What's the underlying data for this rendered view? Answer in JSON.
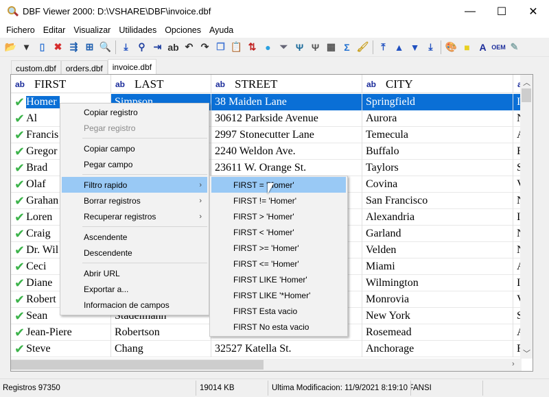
{
  "window": {
    "title": "DBF Viewer 2000: D:\\VSHARE\\DBF\\invoice.dbf",
    "minimize": "—",
    "maximize": "☐",
    "close": "✕"
  },
  "menubar": [
    "Fichero",
    "Editar",
    "Visualizar",
    "Utilidades",
    "Opciones",
    "Ayuda"
  ],
  "toolbar": [
    {
      "name": "open-folder-icon",
      "g": "📂",
      "c": "#d9a520"
    },
    {
      "name": "dropdown-arrow-icon",
      "g": "▾",
      "c": "#333"
    },
    {
      "name": "new-file-icon",
      "g": "▯",
      "c": "#3a7bd5"
    },
    {
      "name": "delete-icon",
      "g": "✖",
      "c": "#d62c2c"
    },
    {
      "name": "link-fields-icon",
      "g": "⇶",
      "c": "#2060b0"
    },
    {
      "name": "structure-icon",
      "g": "⊞",
      "c": "#2060b0"
    },
    {
      "name": "find-icon",
      "g": "🔍",
      "c": "#333"
    },
    "|",
    {
      "name": "goto-record-icon",
      "g": "⤓",
      "c": "#2050c0"
    },
    {
      "name": "binoculars-icon",
      "g": "⚲",
      "c": "#2040a0"
    },
    {
      "name": "find-next-icon",
      "g": "⇥",
      "c": "#2040a0"
    },
    {
      "name": "replace-icon",
      "g": "ab",
      "c": "#333"
    },
    {
      "name": "undo-icon",
      "g": "↶",
      "c": "#333"
    },
    {
      "name": "redo-icon",
      "g": "↷",
      "c": "#333"
    },
    {
      "name": "copy-icon",
      "g": "❐",
      "c": "#4a7bd5"
    },
    {
      "name": "paste-icon",
      "g": "📋",
      "c": "#777"
    },
    {
      "name": "sort-az-icon",
      "g": "⇅",
      "c": "#c02020"
    },
    {
      "name": "comment-icon",
      "g": "●",
      "c": "#2aa0e0"
    },
    {
      "name": "filter-icon",
      "g": "⏷",
      "c": "#667"
    },
    {
      "name": "filter-plus-icon",
      "g": "Ψ",
      "c": "#1a6a9a"
    },
    {
      "name": "filter-clear-icon",
      "g": "Ψ",
      "c": "#555"
    },
    {
      "name": "table-icon",
      "g": "▦",
      "c": "#555"
    },
    {
      "name": "sum-icon",
      "g": "Σ",
      "c": "#2070d0"
    },
    {
      "name": "brush-icon",
      "g": "🖌",
      "c": "#c9a020"
    },
    "|",
    {
      "name": "first-record-icon",
      "g": "⤒",
      "c": "#2050c0"
    },
    {
      "name": "prev-record-icon",
      "g": "▲",
      "c": "#2050c0"
    },
    {
      "name": "next-record-icon",
      "g": "▼",
      "c": "#2050c0"
    },
    {
      "name": "last-record-icon",
      "g": "⤓",
      "c": "#2050c0"
    },
    "|",
    {
      "name": "color-palette-icon",
      "g": "🎨",
      "c": "#c03030"
    },
    {
      "name": "shapes-icon",
      "g": "■",
      "c": "#e8d020"
    },
    {
      "name": "font-icon",
      "g": "A",
      "c": "#1a2b9a"
    },
    {
      "name": "oem-icon",
      "g": "OEM",
      "c": "#1a2b9a"
    },
    {
      "name": "settings-icon",
      "g": "✎",
      "c": "#8aa"
    }
  ],
  "tabs": [
    {
      "label": "custom.dbf"
    },
    {
      "label": "orders.dbf"
    },
    {
      "label": "invoice.dbf",
      "active": true
    }
  ],
  "columns": [
    {
      "type": "ab",
      "name": "FIRST"
    },
    {
      "type": "ab",
      "name": "LAST"
    },
    {
      "type": "ab",
      "name": "STREET"
    },
    {
      "type": "ab",
      "name": "CITY"
    },
    {
      "type": "a",
      "name": ""
    }
  ],
  "rows": [
    [
      "Homer",
      "Simpson",
      "38 Maiden Lane",
      "Springfield",
      "I"
    ],
    [
      "Al",
      "",
      "30612 Parkside Avenue",
      "Aurora",
      "N"
    ],
    [
      "Francis",
      "",
      "2997 Stonecutter Lane",
      "Temecula",
      "A"
    ],
    [
      "Gregor",
      "",
      "2240 Weldon Ave.",
      "Buffalo",
      "F"
    ],
    [
      "Brad",
      "",
      "23611 W. Orange St.",
      "Taylors",
      "S"
    ],
    [
      "Olaf",
      "",
      "",
      "Covina",
      "V"
    ],
    [
      "Grahan",
      "",
      "",
      "San Francisco",
      "N"
    ],
    [
      "Loren",
      "",
      "",
      "Alexandria",
      "I"
    ],
    [
      "Craig",
      "",
      "",
      "Garland",
      "N"
    ],
    [
      "Dr. Wil",
      "",
      "",
      "Velden",
      "N"
    ],
    [
      "Ceci",
      "",
      "",
      "Miami",
      "A"
    ],
    [
      "Diane",
      "",
      "",
      "Wilmington",
      "I"
    ],
    [
      "Robert",
      "",
      "",
      "Monrovia",
      "V"
    ],
    [
      "Sean",
      "Stadelmann",
      "",
      "New York",
      "S"
    ],
    [
      "Jean-Piere",
      "Robertson",
      "",
      "Rosemead",
      "A"
    ],
    [
      "Steve",
      "Chang",
      "32527 Katella St.",
      "Anchorage",
      "F"
    ]
  ],
  "selected_row": 0,
  "context_menu": [
    {
      "label": "Copiar registro"
    },
    {
      "label": "Pegar registro",
      "disabled": true
    },
    "sep",
    {
      "label": "Copiar campo"
    },
    {
      "label": "Pegar campo"
    },
    "sep",
    {
      "label": "Filtro rapido",
      "submenu": true,
      "highlighted": true
    },
    {
      "label": "Borrar registros",
      "submenu": true
    },
    {
      "label": "Recuperar registros",
      "submenu": true
    },
    "sep",
    {
      "label": "Ascendente"
    },
    {
      "label": "Descendente"
    },
    "sep",
    {
      "label": "Abrir URL"
    },
    {
      "label": "Exportar a..."
    },
    {
      "label": "Informacion de campos"
    }
  ],
  "submenu": [
    {
      "label": "FIRST = 'Homer'",
      "highlighted": true
    },
    {
      "label": "FIRST != 'Homer'"
    },
    {
      "label": "FIRST > 'Homer'"
    },
    {
      "label": "FIRST < 'Homer'"
    },
    {
      "label": "FIRST >= 'Homer'"
    },
    {
      "label": "FIRST <= 'Homer'"
    },
    {
      "label": "FIRST LIKE 'Homer'"
    },
    {
      "label": "FIRST LIKE '*Homer'"
    },
    {
      "label": "FIRST Esta vacio"
    },
    {
      "label": "FIRST No esta vacio"
    }
  ],
  "status": {
    "records": "Registros 97350",
    "size": "19014 KB",
    "modified": "Ultima Modificacion: 11/9/2021 8:19:10 P",
    "encoding": "ANSI"
  }
}
